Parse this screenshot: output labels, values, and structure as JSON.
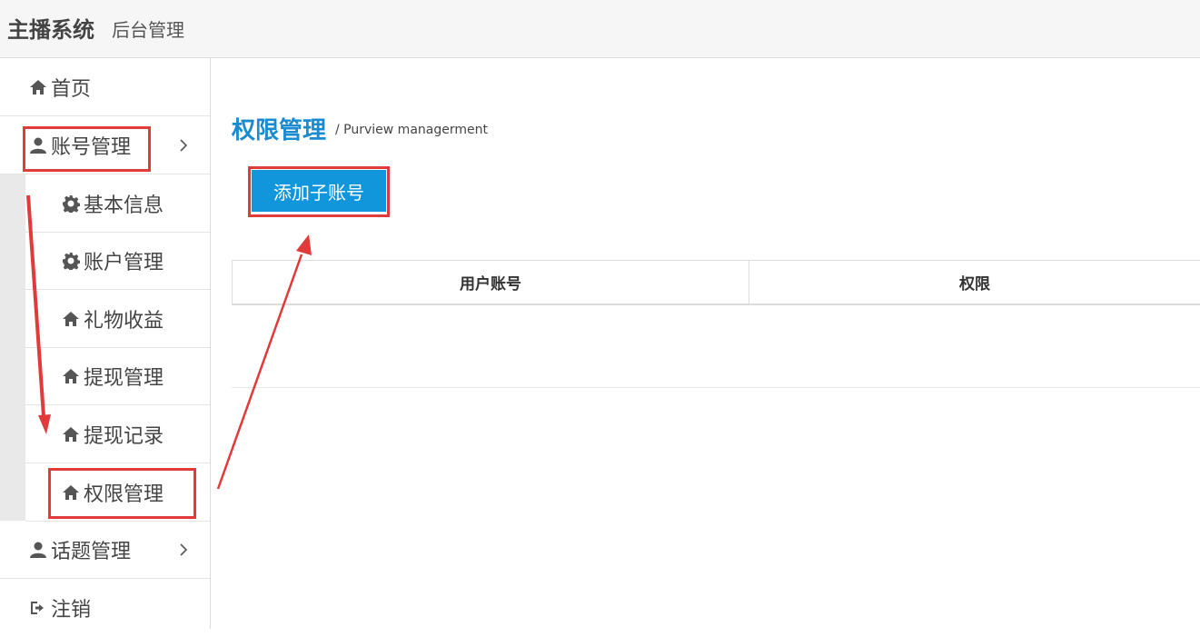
{
  "header": {
    "brand": "主播系统",
    "subtitle": "后台管理"
  },
  "sidebar": {
    "items": [
      {
        "label": "首页",
        "icon": "home-icon"
      },
      {
        "label": "账号管理",
        "icon": "user-icon",
        "expanded": true
      },
      {
        "label": "基本信息",
        "icon": "gear-icon"
      },
      {
        "label": "账户管理",
        "icon": "gear-icon"
      },
      {
        "label": "礼物收益",
        "icon": "home-icon"
      },
      {
        "label": "提现管理",
        "icon": "home-icon"
      },
      {
        "label": "提现记录",
        "icon": "home-icon"
      },
      {
        "label": "权限管理",
        "icon": "home-icon",
        "active": true
      },
      {
        "label": "话题管理",
        "icon": "user-icon"
      },
      {
        "label": "注销",
        "icon": "sign-out-icon"
      }
    ]
  },
  "main": {
    "title": "权限管理",
    "subtitle": "/ Purview managerment",
    "add_button": "添加子账号",
    "table": {
      "columns": [
        "用户账号",
        "权限"
      ],
      "rows": []
    }
  },
  "colors": {
    "accent": "#1296db",
    "title": "#1a8bd0",
    "annotation": "#e03a3a"
  }
}
